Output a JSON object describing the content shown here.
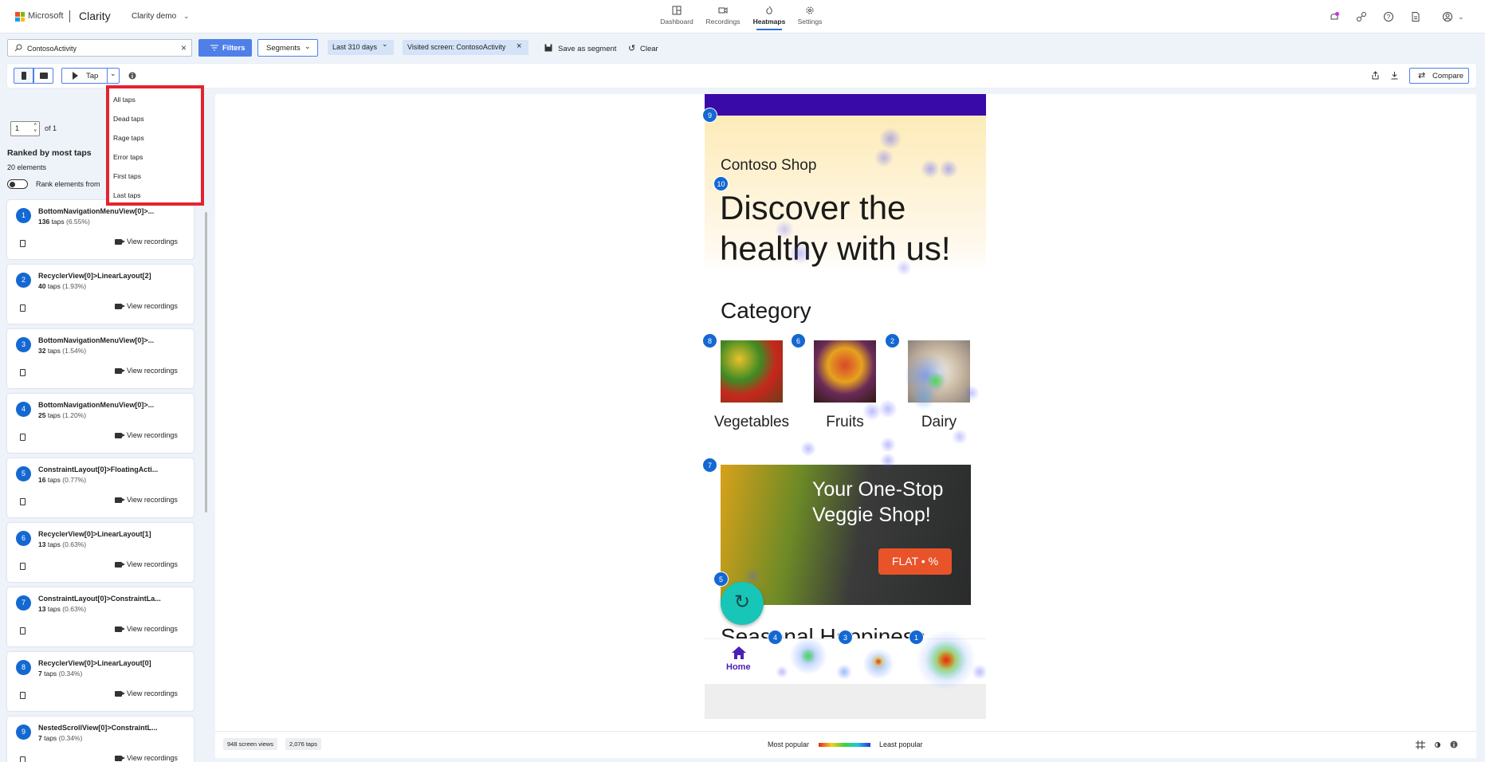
{
  "header": {
    "brand": "Microsoft",
    "product": "Clarity",
    "project": "Clarity demo",
    "tabs": [
      {
        "label": "Dashboard",
        "icon": "dashboard-icon"
      },
      {
        "label": "Recordings",
        "icon": "camera-icon"
      },
      {
        "label": "Heatmaps",
        "icon": "flame-icon",
        "active": true
      },
      {
        "label": "Settings",
        "icon": "gear-icon"
      }
    ]
  },
  "filterbar": {
    "search_value": "ContosoActivity",
    "filters_label": "Filters",
    "segments_label": "Segments",
    "date_range": "Last 310 days",
    "visited_screen": "Visited screen: ContosoActivity",
    "save_segment": "Save as segment",
    "clear": "Clear"
  },
  "toolbar": {
    "mode_label": "Tap",
    "compare_label": "Compare"
  },
  "dropdown": {
    "items": [
      "All taps",
      "Dead taps",
      "Rage taps",
      "Error taps",
      "First taps",
      "Last taps"
    ]
  },
  "sidebar": {
    "page_value": "1",
    "of_label": "of 1",
    "ranked_title": "Ranked by most taps",
    "element_count": "20 elements",
    "rank_toggle_label": "Rank elements from",
    "view_recordings": "View recordings",
    "items": [
      {
        "rank": "1",
        "selector": "BottomNavigationMenuView[0]>...",
        "taps": "136",
        "unit": "taps",
        "pct": "(6.55%)"
      },
      {
        "rank": "2",
        "selector": "RecyclerView[0]>LinearLayout[2]",
        "taps": "40",
        "unit": "taps",
        "pct": "(1.93%)"
      },
      {
        "rank": "3",
        "selector": "BottomNavigationMenuView[0]>...",
        "taps": "32",
        "unit": "taps",
        "pct": "(1.54%)"
      },
      {
        "rank": "4",
        "selector": "BottomNavigationMenuView[0]>...",
        "taps": "25",
        "unit": "taps",
        "pct": "(1.20%)"
      },
      {
        "rank": "5",
        "selector": "ConstraintLayout[0]>FloatingActi...",
        "taps": "16",
        "unit": "taps",
        "pct": "(0.77%)"
      },
      {
        "rank": "6",
        "selector": "RecyclerView[0]>LinearLayout[1]",
        "taps": "13",
        "unit": "taps",
        "pct": "(0.63%)"
      },
      {
        "rank": "7",
        "selector": "ConstraintLayout[0]>ConstraintLa...",
        "taps": "13",
        "unit": "taps",
        "pct": "(0.63%)"
      },
      {
        "rank": "8",
        "selector": "RecyclerView[0]>LinearLayout[0]",
        "taps": "7",
        "unit": "taps",
        "pct": "(0.34%)"
      },
      {
        "rank": "9",
        "selector": "NestedScrollView[0]>ConstraintL...",
        "taps": "7",
        "unit": "taps",
        "pct": "(0.34%)"
      }
    ]
  },
  "app_preview": {
    "shop_name": "Contoso Shop",
    "headline_line1": "Discover the",
    "headline_line2": "healthy with us!",
    "category_title": "Category",
    "categories": [
      "Vegetables",
      "Fruits",
      "Dairy"
    ],
    "banner_line1": "Your One-Stop",
    "banner_line2": "Veggie Shop!",
    "banner_cta": "FLAT • %",
    "seasonal_title": "Seasonal Happiness",
    "nav_home": "Home",
    "colors": {
      "header_bar": "#3a0aa8",
      "accent": "#1468d2",
      "cta": "#e8532a",
      "fab": "#17c6b6"
    }
  },
  "badges": [
    {
      "label": "9"
    },
    {
      "label": "10"
    },
    {
      "label": "8"
    },
    {
      "label": "6"
    },
    {
      "label": "2"
    },
    {
      "label": "7"
    },
    {
      "label": "5"
    },
    {
      "label": "4"
    },
    {
      "label": "3"
    },
    {
      "label": "1"
    }
  ],
  "footer": {
    "screen_views": "948 screen views",
    "taps": "2,076 taps",
    "legend_most": "Most popular",
    "legend_least": "Least popular"
  }
}
